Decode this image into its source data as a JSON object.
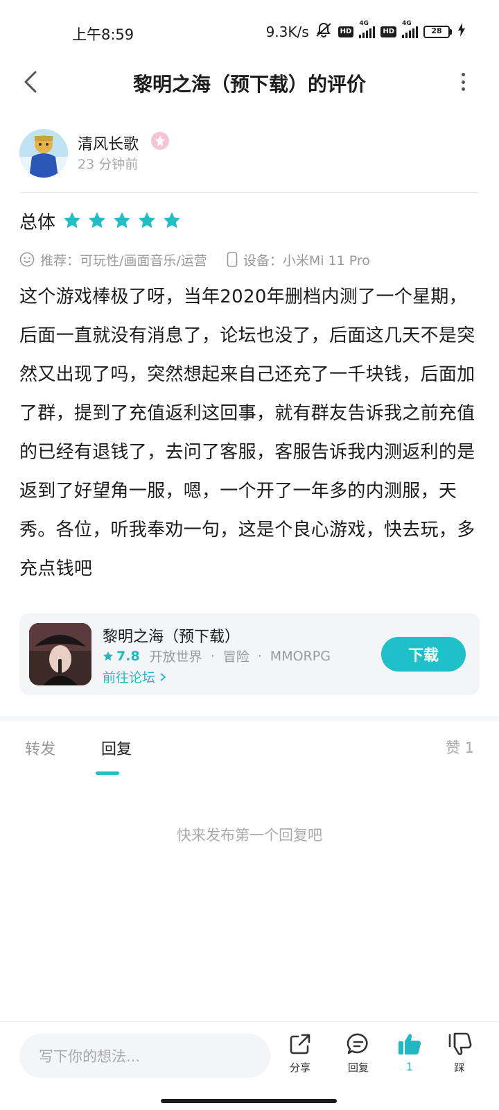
{
  "status_bar": {
    "time": "上午8:59",
    "net_speed": "9.3K/s",
    "battery_level": "28"
  },
  "header": {
    "title": "黎明之海（预下载）的评价"
  },
  "author": {
    "name": "清风长歌",
    "time": "23 分钟前"
  },
  "rating": {
    "label": "总体",
    "stars": 5,
    "star_color": "#1fc0c8"
  },
  "meta": {
    "recommend": "推荐：可玩性/画面音乐/运营",
    "device": "设备：小米Mi 11 Pro"
  },
  "review": {
    "text": "这个游戏棒极了呀，当年2020年删档内测了一个星期，后面一直就没有消息了，论坛也没了，后面这几天不是突然又出现了吗，突然想起来自己还充了一千块钱，后面加了群，提到了充值返利这回事，就有群友告诉我之前充值的已经有退钱了，去问了客服，客服告诉我内测返利的是返到了好望角一服，嗯，一个开了一年多的内测服，天秀。各位，听我奉劝一句，这是个良心游戏，快去玩，多充点钱吧"
  },
  "game": {
    "name": "黎明之海（预下载）",
    "score": "7.8",
    "tags": [
      "开放世界",
      "冒险",
      "MMORPG"
    ],
    "forum_link": "前往论坛",
    "download_label": "下载"
  },
  "tabs": {
    "forward": "转发",
    "reply": "回复",
    "like": "赞 1"
  },
  "empty_state": "快来发布第一个回复吧",
  "bottom_bar": {
    "input_placeholder": "写下你的想法...",
    "share": "分享",
    "reply": "回复",
    "like_count": "1",
    "dislike": "踩"
  },
  "colors": {
    "accent": "#1fc0c8",
    "text": "#1c1c1c",
    "muted": "#999999"
  }
}
